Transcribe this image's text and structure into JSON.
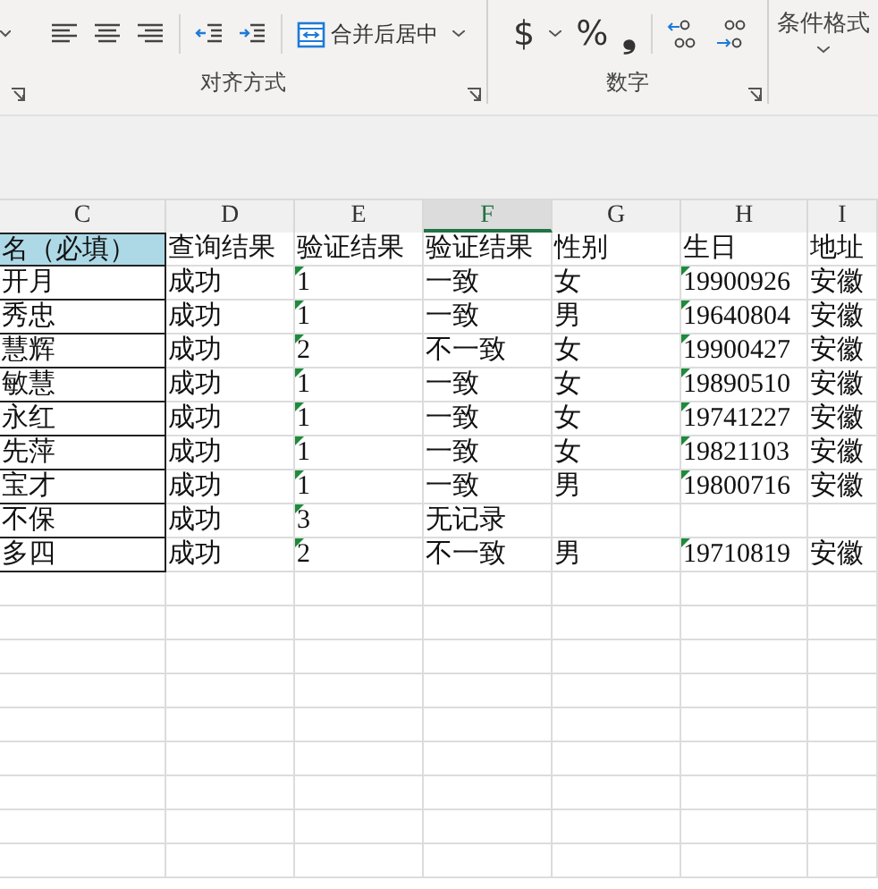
{
  "ribbon": {
    "groups": [
      {
        "label": "对齐方式",
        "merge_button": "合并后居中"
      },
      {
        "label": "数字",
        "symbols": [
          "$",
          "%",
          "❟"
        ]
      },
      {
        "button": "条件格式"
      }
    ]
  },
  "columns": [
    {
      "label": "C",
      "selected": false
    },
    {
      "label": "D",
      "selected": false
    },
    {
      "label": "E",
      "selected": false
    },
    {
      "label": "F",
      "selected": true
    },
    {
      "label": "G",
      "selected": false
    },
    {
      "label": "H",
      "selected": false
    },
    {
      "label": "I",
      "selected": false
    }
  ],
  "rows": [
    {
      "cells": [
        {
          "text": "名（必填）",
          "header": true
        },
        {
          "text": "查询结果"
        },
        {
          "text": "验证结果"
        },
        {
          "text": "验证结果"
        },
        {
          "text": "性别"
        },
        {
          "text": "生日"
        },
        {
          "text": "地址"
        }
      ]
    },
    {
      "cells": [
        {
          "text": "开月"
        },
        {
          "text": "成功"
        },
        {
          "text": "1",
          "flagged": true
        },
        {
          "text": "一致"
        },
        {
          "text": "女"
        },
        {
          "text": "19900926",
          "flagged": true
        },
        {
          "text": "安徽"
        }
      ]
    },
    {
      "cells": [
        {
          "text": "秀忠"
        },
        {
          "text": "成功"
        },
        {
          "text": "1",
          "flagged": true
        },
        {
          "text": "一致"
        },
        {
          "text": "男"
        },
        {
          "text": "19640804",
          "flagged": true
        },
        {
          "text": "安徽"
        }
      ]
    },
    {
      "cells": [
        {
          "text": "慧辉"
        },
        {
          "text": "成功"
        },
        {
          "text": "2",
          "flagged": true
        },
        {
          "text": "不一致"
        },
        {
          "text": "女"
        },
        {
          "text": "19900427",
          "flagged": true
        },
        {
          "text": "安徽"
        }
      ]
    },
    {
      "cells": [
        {
          "text": "敏慧"
        },
        {
          "text": "成功"
        },
        {
          "text": "1",
          "flagged": true
        },
        {
          "text": "一致"
        },
        {
          "text": "女"
        },
        {
          "text": "19890510",
          "flagged": true
        },
        {
          "text": "安徽"
        }
      ]
    },
    {
      "cells": [
        {
          "text": "永红"
        },
        {
          "text": "成功"
        },
        {
          "text": "1",
          "flagged": true
        },
        {
          "text": "一致"
        },
        {
          "text": "女"
        },
        {
          "text": "19741227",
          "flagged": true
        },
        {
          "text": "安徽"
        }
      ]
    },
    {
      "cells": [
        {
          "text": "先萍"
        },
        {
          "text": "成功"
        },
        {
          "text": "1",
          "flagged": true
        },
        {
          "text": "一致"
        },
        {
          "text": "女"
        },
        {
          "text": "19821103",
          "flagged": true
        },
        {
          "text": "安徽"
        }
      ]
    },
    {
      "cells": [
        {
          "text": "宝才"
        },
        {
          "text": "成功"
        },
        {
          "text": "1",
          "flagged": true
        },
        {
          "text": "一致"
        },
        {
          "text": "男"
        },
        {
          "text": "19800716",
          "flagged": true
        },
        {
          "text": "安徽"
        }
      ]
    },
    {
      "cells": [
        {
          "text": "不保"
        },
        {
          "text": "成功"
        },
        {
          "text": "3",
          "flagged": true
        },
        {
          "text": "无记录"
        },
        null,
        null,
        null
      ]
    },
    {
      "cells": [
        {
          "text": "多四"
        },
        {
          "text": "成功"
        },
        {
          "text": "2",
          "flagged": true
        },
        {
          "text": "不一致"
        },
        {
          "text": "男"
        },
        {
          "text": "19710819",
          "flagged": true
        },
        {
          "text": "安徽"
        }
      ]
    }
  ]
}
